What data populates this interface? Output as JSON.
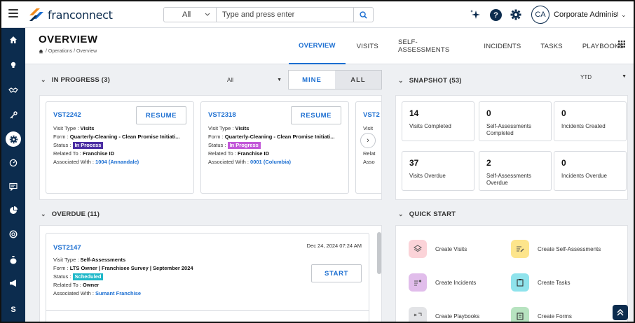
{
  "header": {
    "logo_text": "franconnect",
    "search": {
      "scope": "All",
      "placeholder": "Type and press enter"
    },
    "user": {
      "initials": "CA",
      "name": "Corporate Administr..."
    }
  },
  "sidebar": {
    "items": [
      {
        "icon": "home-icon"
      },
      {
        "icon": "lightbulb-icon"
      },
      {
        "icon": "handshake-icon"
      },
      {
        "icon": "key-icon"
      },
      {
        "icon": "gear-icon",
        "active": true
      },
      {
        "icon": "gauge-icon"
      },
      {
        "icon": "chat-icon"
      },
      {
        "icon": "pie-icon"
      },
      {
        "icon": "lifebuoy-icon"
      },
      {
        "icon": "money-bag-icon"
      },
      {
        "icon": "megaphone-icon"
      },
      {
        "icon": "s-icon",
        "label": "S"
      }
    ]
  },
  "page": {
    "title": "OVERVIEW",
    "breadcrumb": "/ Operations / Overview",
    "tabs": [
      "OVERVIEW",
      "VISITS",
      "SELF-ASSESSMENTS",
      "INCIDENTS",
      "TASKS",
      "PLAYBOOKS"
    ]
  },
  "in_progress": {
    "title": "IN PROGRESS (3)",
    "filter": "All",
    "toggle": {
      "on": "MINE",
      "off": "ALL"
    },
    "cards": [
      {
        "id": "VST2242",
        "button": "RESUME",
        "visit_type_label": "Visit Type :",
        "visit_type": "Visits",
        "form_label": "Form :",
        "form": "Quarterly-Cleaning - Clean Promise Initiati...",
        "status_label": "Status :",
        "status": "In Process",
        "status_color": "#4b2ea3",
        "related_label": "Related To :",
        "related": "Franchise ID",
        "assoc_label": "Associated With :",
        "assoc": "1004 (Annandale)"
      },
      {
        "id": "VST2318",
        "button": "RESUME",
        "visit_type_label": "Visit Type :",
        "visit_type": "Visits",
        "form_label": "Form :",
        "form": "Quarterly-Cleaning - Clean Promise Initiati...",
        "status_label": "Status :",
        "status": "In Progress",
        "status_color": "#c257d8",
        "related_label": "Related To :",
        "related": "Franchise ID",
        "assoc_label": "Associated With :",
        "assoc": "0001 (Columbia)"
      },
      {
        "id": "VST2",
        "visit_type_label": "Visit",
        "related_label": "Relat",
        "assoc_label": "Asso"
      }
    ]
  },
  "overdue": {
    "title": "OVERDUE (11)",
    "card": {
      "id": "VST2147",
      "date": "Dec 24, 2024 07:24 AM",
      "button": "START",
      "visit_type_label": "Visit Type :",
      "visit_type": "Self-Assessments",
      "form_label": "Form :",
      "form": "LTS Owner | Franchisee Survey | September 2024",
      "status_label": "Status :",
      "status": "Scheduled",
      "status_color": "#1fb8c9",
      "related_label": "Related To :",
      "related": "Owner",
      "assoc_label": "Associated With :",
      "assoc": "Sumant Franchise"
    }
  },
  "snapshot": {
    "title": "SNAPSHOT (53)",
    "period": "YTD",
    "stats": [
      {
        "num": "14",
        "label": "Visits Completed"
      },
      {
        "num": "0",
        "label": "Self-Assessments Completed"
      },
      {
        "num": "0",
        "label": "Incidents Created"
      },
      {
        "num": "37",
        "label": "Visits Overdue"
      },
      {
        "num": "2",
        "label": "Self-Assessments Overdue"
      },
      {
        "num": "0",
        "label": "Incidents Overdue"
      }
    ]
  },
  "quick_start": {
    "title": "QUICK START",
    "items": [
      {
        "label": "Create Visits",
        "color": "#fbd3d8",
        "icon": "layers-icon"
      },
      {
        "label": "Create Self-Assessments",
        "color": "#fde58c",
        "icon": "list-edit-icon"
      },
      {
        "label": "Create Incidents",
        "color": "#e1bdeb",
        "icon": "list-alert-icon"
      },
      {
        "label": "Create Tasks",
        "color": "#8fe3ec",
        "icon": "clipboard-icon"
      },
      {
        "label": "Create Playbooks",
        "color": "#e3e4e7",
        "icon": "playbook-icon"
      },
      {
        "label": "Create Forms",
        "color": "#b7e3c0",
        "icon": "form-icon"
      }
    ]
  }
}
